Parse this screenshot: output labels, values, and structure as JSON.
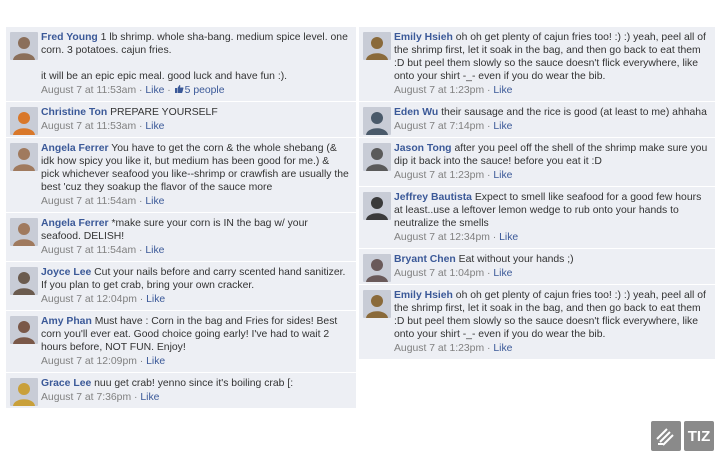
{
  "left_comments": [
    {
      "author": "Fred Young",
      "text": "1 lb shrimp. whole sha-bang. medium spice level. one corn. 3 potatoes. cajun fries.\n\nit will be an epic epic meal. good luck and have fun :).",
      "time": "August 7 at 11:53am",
      "sep": " · ",
      "like": "Like",
      "sep2": " · ",
      "people": "5 people",
      "avatar_color": "#8b6f5a"
    },
    {
      "author": "Christine Ton",
      "text": "PREPARE YOURSELF",
      "time": "August 7 at 11:53am",
      "sep": " · ",
      "like": "Like",
      "avatar_color": "#d9782a"
    },
    {
      "author": "Angela Ferrer",
      "text": "You have to get the corn & the whole shebang (& idk how spicy you like it, but medium has been good for me.) & pick whichever seafood you like--shrimp or crawfish are usually the best 'cuz they soakup the flavor of the sauce more",
      "time": "August 7 at 11:54am",
      "sep": " · ",
      "like": "Like",
      "avatar_color": "#a07a5e"
    },
    {
      "author": "Angela Ferrer",
      "text": "*make sure your corn is IN the bag w/ your seafood. DELISH!",
      "time": "August 7 at 11:54am",
      "sep": " · ",
      "like": "Like",
      "avatar_color": "#a07a5e"
    },
    {
      "author": "Joyce Lee",
      "text": "Cut your nails before and carry scented hand sanitizer. If you plan to get crab, bring your own cracker.",
      "time": "August 7 at 12:04pm",
      "sep": " · ",
      "like": "Like",
      "avatar_color": "#6b5b4e"
    },
    {
      "author": "Amy Phan",
      "text": "Must have : Corn in the bag and Fries for sides! Best corn you'll ever eat. Good choice going early! I've had to wait 2 hours before, NOT FUN. Enjoy!",
      "time": "August 7 at 12:09pm",
      "sep": " · ",
      "like": "Like",
      "avatar_color": "#7a5848"
    },
    {
      "author": "Grace Lee",
      "text": "nuu get crab! yenno since it's boiling crab [:",
      "time": "August 7 at 7:36pm",
      "sep": " · ",
      "like": "Like",
      "avatar_color": "#c9a03a"
    }
  ],
  "right_comments": [
    {
      "author": "Emily Hsieh",
      "text": "oh oh get plenty of cajun fries too! :) :) yeah, peel all of the shrimp first, let it soak in the bag, and then go back to eat them :D but peel them slowly so the sauce doesn't flick everywhere, like onto your shirt -_- even if you do wear the bib.",
      "time": "August 7 at 1:23pm",
      "sep": " · ",
      "like": "Like",
      "avatar_color": "#8a6a3a"
    },
    {
      "author": "Eden Wu",
      "text": "their sausage and the rice is good (at least to me) ahhaha",
      "time": "August 7 at 7:14pm",
      "sep": " · ",
      "like": "Like",
      "avatar_color": "#4a5a6a"
    },
    {
      "author": "Jason Tong",
      "text": "after you peel off the shell of the shrimp make sure you dip it back into the sauce! before you eat it :D",
      "time": "August 7 at 1:23pm",
      "sep": " · ",
      "like": "Like",
      "avatar_color": "#5a5a5a"
    },
    {
      "author": "Jeffrey Bautista",
      "text": "Expect to smell like seafood for a good few hours at least..use a leftover lemon wedge to rub onto your hands to neutralize the smells",
      "time": "August 7 at 12:34pm",
      "sep": " · ",
      "like": "Like",
      "avatar_color": "#3a3a3a"
    },
    {
      "author": "Bryant Chen",
      "text": "Eat without your hands ;)",
      "time": "August 7 at 1:04pm",
      "sep": " · ",
      "like": "Like",
      "avatar_color": "#6a5a5a"
    },
    {
      "author": "Emily Hsieh",
      "text": "oh oh get plenty of cajun fries too! :) :) yeah, peel all of the shrimp first, let it soak in the bag, and then go back to eat them :D but peel them slowly so the sauce doesn't flick everywhere, like onto your shirt -_- even if you do wear the bib.",
      "time": "August 7 at 1:23pm",
      "sep": " · ",
      "like": "Like",
      "avatar_color": "#8a6a3a"
    }
  ],
  "watermark": {
    "right_text": "TIZ"
  },
  "colors": {
    "panel_bg": "#edeff4",
    "link": "#3b5998",
    "meta": "#808080",
    "text": "#333333"
  }
}
